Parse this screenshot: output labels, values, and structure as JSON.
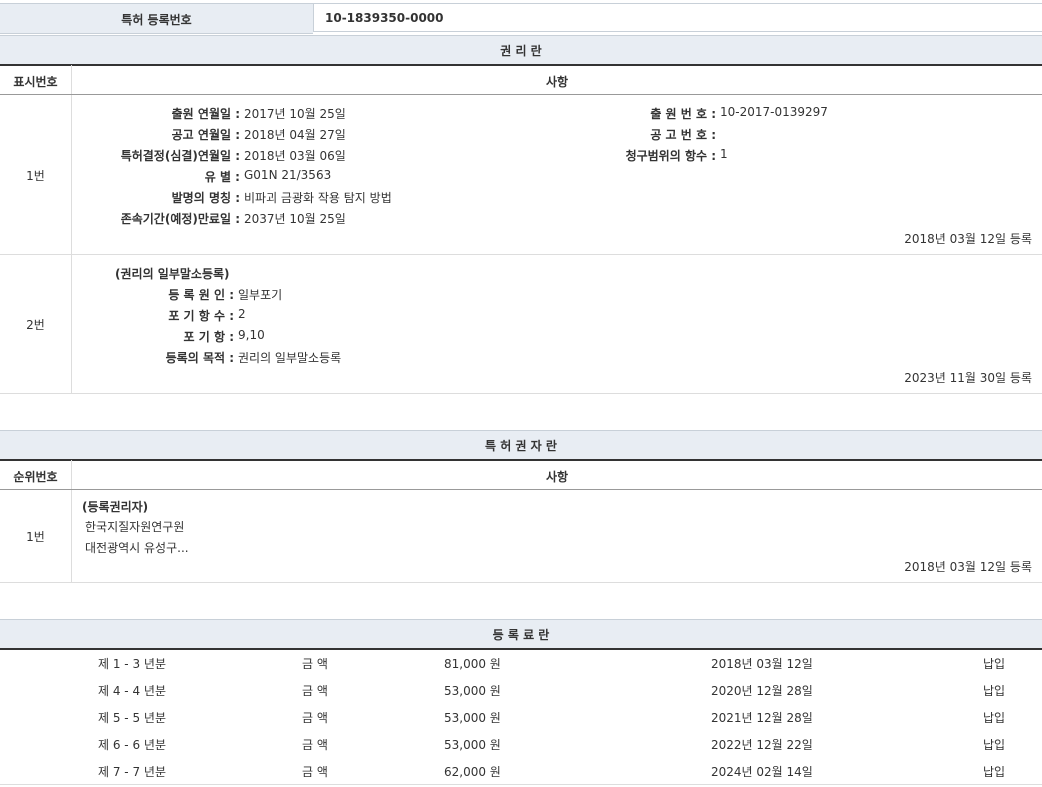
{
  "patent_reg": {
    "label": "특허 등록번호",
    "value": "10-1839350-0000"
  },
  "rights": {
    "title": "권 리 란",
    "col_no": "표시번호",
    "col_item": "사항",
    "row1": {
      "no": "1번",
      "left": [
        {
          "label": "출원 연월일 :",
          "value": "2017년 10월 25일"
        },
        {
          "label": "공고 연월일 :",
          "value": "2018년 04월 27일"
        },
        {
          "label": "특허결정(심결)연월일 :",
          "value": "2018년 03월 06일"
        },
        {
          "label": "유 별 :",
          "value": "G01N 21/3563"
        },
        {
          "label": "발명의 명칭 :",
          "value": "비파괴 금광화 작용 탐지 방법"
        },
        {
          "label": "존속기간(예정)만료일 :",
          "value": "2037년 10월 25일"
        }
      ],
      "right": [
        {
          "label": "출 원 번 호 :",
          "value": "10-2017-0139297"
        },
        {
          "label": "공 고 번 호 :",
          "value": ""
        },
        {
          "label": "청구범위의 항수 :",
          "value": "1"
        }
      ],
      "date": "2018년 03월 12일 등록"
    },
    "row2": {
      "no": "2번",
      "heading": "(권리의 일부말소등록)",
      "fields": [
        {
          "label": "등 록 원 인 :",
          "value": "일부포기"
        },
        {
          "label": "포 기 항 수 :",
          "value": "2"
        },
        {
          "label": "포 기 항 :",
          "value": "9,10"
        },
        {
          "label": "등록의 목적 :",
          "value": "권리의 일부말소등록"
        }
      ],
      "date": "2023년 11월 30일 등록"
    }
  },
  "holders": {
    "title": "특 허 권 자 란",
    "col_no": "순위번호",
    "col_item": "사항",
    "row1": {
      "no": "1번",
      "heading": "(등록권리자)",
      "name": "한국지질자원연구원",
      "address": "대전광역시 유성구...",
      "date": "2018년 03월 12일 등록"
    }
  },
  "fees": {
    "title": "등 록 료 란",
    "rows": [
      {
        "period": "제 1 - 3 년분",
        "label": "금 액",
        "amount": "81,000 원",
        "date": "2018년 03월 12일",
        "status": "납입"
      },
      {
        "period": "제 4 - 4 년분",
        "label": "금 액",
        "amount": "53,000 원",
        "date": "2020년 12월 28일",
        "status": "납입"
      },
      {
        "period": "제 5 - 5 년분",
        "label": "금 액",
        "amount": "53,000 원",
        "date": "2021년 12월 28일",
        "status": "납입"
      },
      {
        "period": "제 6 - 6 년분",
        "label": "금 액",
        "amount": "53,000 원",
        "date": "2022년 12월 22일",
        "status": "납입"
      },
      {
        "period": "제 7 - 7 년분",
        "label": "금 액",
        "amount": "62,000 원",
        "date": "2024년 02월 14일",
        "status": "납입"
      }
    ]
  }
}
